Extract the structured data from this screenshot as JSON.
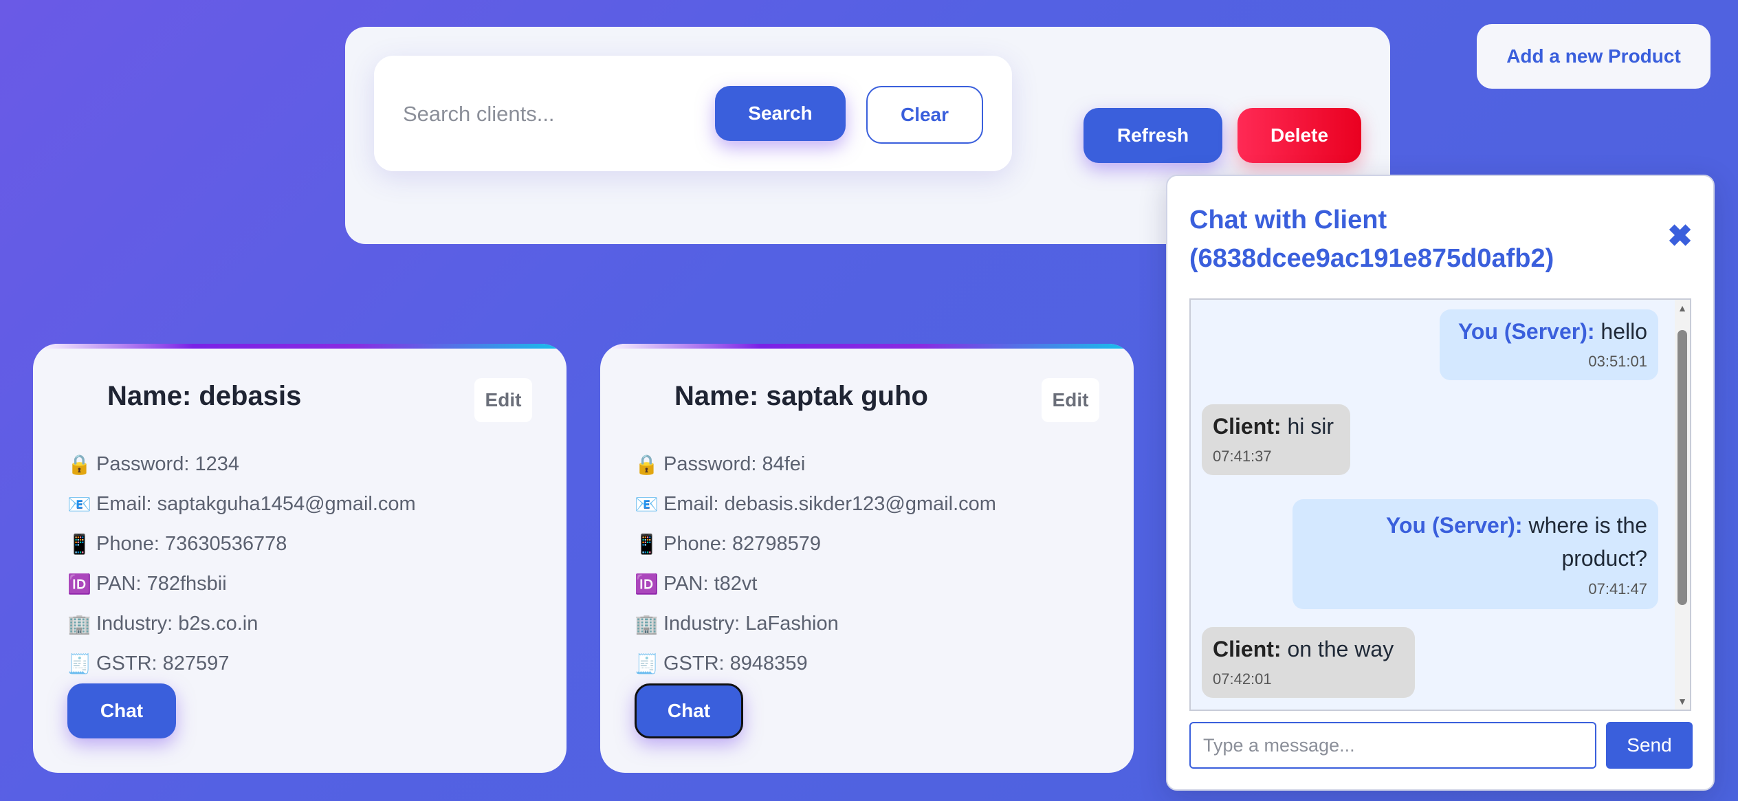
{
  "toolbar": {
    "search_placeholder": "Search clients...",
    "search_label": "Search",
    "clear_label": "Clear",
    "refresh_label": "Refresh",
    "delete_label": "Delete",
    "add_product_label": "Add a new Product"
  },
  "clients": [
    {
      "name": "Name: debasis",
      "edit_label": "Edit",
      "password": "Password: 1234",
      "email": "Email: saptakguha1454@gmail.com",
      "phone": "Phone: 73630536778",
      "pan": "PAN: 782fhsbii",
      "industry": "Industry: b2s.co.in",
      "gstr": "GSTR: 827597",
      "chat_label": "Chat"
    },
    {
      "name": "Name: saptak guho",
      "edit_label": "Edit",
      "password": "Password: 84fei",
      "email": "Email: debasis.sikder123@gmail.com",
      "phone": "Phone: 82798579",
      "pan": "PAN: t82vt",
      "industry": "Industry: LaFashion",
      "gstr": "GSTR: 8948359",
      "chat_label": "Chat"
    }
  ],
  "icons": {
    "lock": "🔒",
    "email": "📧",
    "phone": "📱",
    "id": "🆔",
    "building": "🏢",
    "receipt": "🧾",
    "close": "✖"
  },
  "chat": {
    "title": "Chat with Client (6838dcee9ac191e875d0afb2)",
    "messages": [
      {
        "sender": "You (Server):",
        "text": "hello",
        "time": "03:51:01"
      },
      {
        "sender": "Client:",
        "text": "hi sir",
        "time": "07:41:37"
      },
      {
        "sender": "You (Server):",
        "text": "where is the product?",
        "time": "07:41:47"
      },
      {
        "sender": "Client:",
        "text": "on the way",
        "time": "07:42:01"
      }
    ],
    "input_placeholder": "Type a message...",
    "send_label": "Send"
  },
  "colors": {
    "accent": "#3a5fdc",
    "danger": "#f0103a",
    "background_start": "#6a5ae6",
    "background_end": "#4b63dd"
  }
}
